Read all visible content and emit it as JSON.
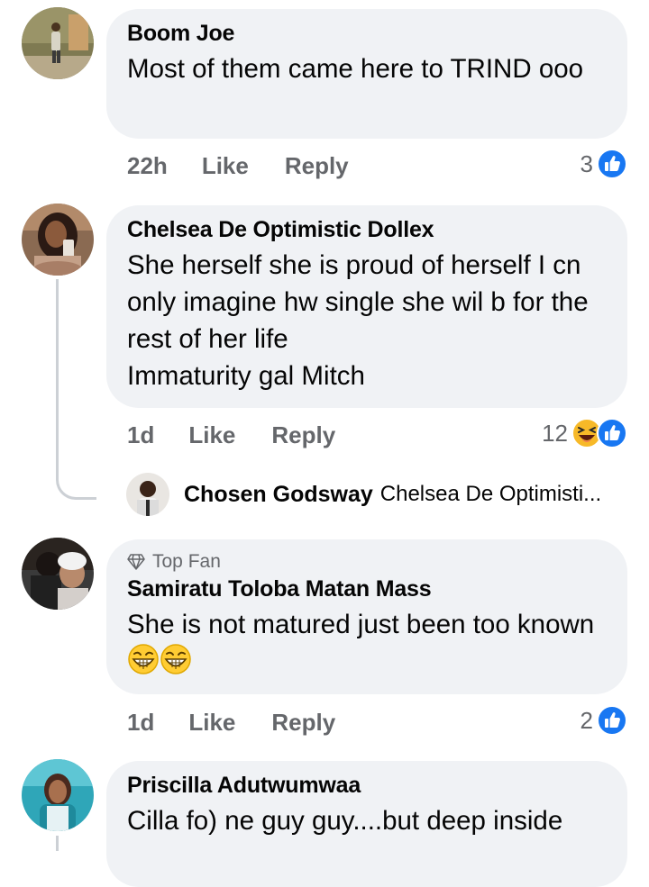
{
  "comments": [
    {
      "author": "Boom Joe",
      "text": "Most of them came here to TRIND ooo",
      "time": "22h",
      "like_label": "Like",
      "reply_label": "Reply",
      "reaction_count": "3",
      "reactions": [
        "like-icon"
      ]
    },
    {
      "author": "Chelsea De Optimistic Dollex",
      "text": "She herself she is proud of herself I cn only imagine hw single she wil b for the rest of her life\nImmaturity gal Mitch",
      "time": "1d",
      "like_label": "Like",
      "reply_label": "Reply",
      "reaction_count": "12",
      "reactions": [
        "laugh-icon",
        "like-icon"
      ],
      "reply_preview": {
        "author": "Chosen Godsway",
        "text": "Chelsea De Optimisti..."
      }
    },
    {
      "badge": "Top Fan",
      "author": "Samiratu Toloba Matan Mass",
      "text": "She is not matured just been too known",
      "emojis": [
        "grinning-squinting-face",
        "grinning-squinting-face"
      ],
      "time": "1d",
      "like_label": "Like",
      "reply_label": "Reply",
      "reaction_count": "2",
      "reactions": [
        "like-icon"
      ]
    },
    {
      "author": "Priscilla Adutwumwaa",
      "text": "Cilla fo) ne guy guy....but deep inside"
    }
  ],
  "colors": {
    "bubble": "#f0f2f5",
    "secondary_text": "#65676b",
    "like_blue": "#1877f2",
    "laugh_yellow": "#f7b928",
    "thread_line": "#ccd0d5"
  }
}
